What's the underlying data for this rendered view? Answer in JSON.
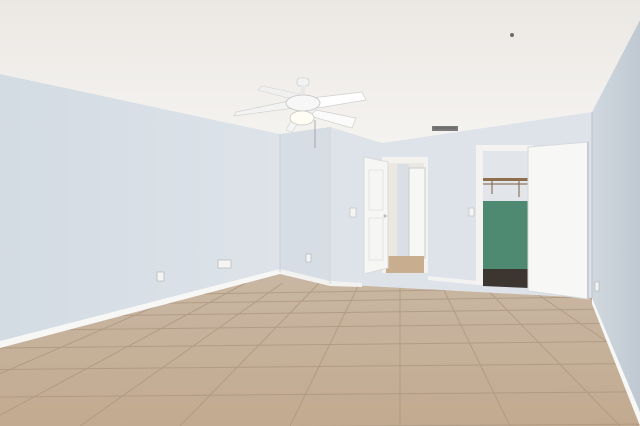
{
  "scene": {
    "description_free": true,
    "colors": {
      "ceiling": "#f1efec",
      "ceiling_shadow": "#e3e0dc",
      "wall_left": "#d9e0e7",
      "wall_back": "#dfe5eb",
      "wall_right": "#c9d1d9",
      "baseboard": "#f7f7f5",
      "floor": "#c7b29b",
      "floor_grout": "#a9937c",
      "door": "#f6f6f4",
      "door_frame": "#f2f2f0",
      "closet_wall": "#4f8a72",
      "closet_shelf": "#8a6a4a",
      "hallway": "#e9e6e0",
      "fan_blade": "#ffffff",
      "fan_body": "#f4f4f4",
      "vent": "#6a6a6a"
    },
    "icons": {
      "fan": "ceiling-fan-icon",
      "vent": "air-vent-icon",
      "outlet": "power-outlet-icon",
      "switch": "light-switch-icon"
    }
  }
}
